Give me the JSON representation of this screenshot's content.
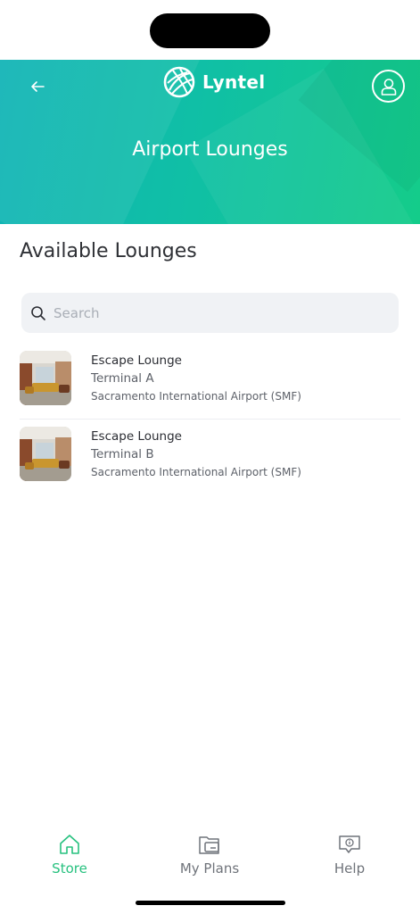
{
  "header": {
    "brand_name": "Lyntel",
    "page_title": "Airport Lounges",
    "icons": {
      "back": "arrow-left-icon",
      "logo": "globe-icon",
      "profile": "user-icon"
    }
  },
  "main": {
    "section_title": "Available Lounges",
    "search": {
      "placeholder": "Search",
      "value": ""
    },
    "lounges": [
      {
        "name": "Escape Lounge",
        "terminal": "Terminal A",
        "airport": "Sacramento International Airport (SMF)"
      },
      {
        "name": "Escape Lounge",
        "terminal": "Terminal B",
        "airport": "Sacramento International Airport (SMF)"
      }
    ]
  },
  "tab_bar": {
    "tabs": [
      {
        "label": "Store",
        "icon": "home-icon",
        "active": true
      },
      {
        "label": "My Plans",
        "icon": "folder-card-icon",
        "active": false
      },
      {
        "label": "Help",
        "icon": "help-chat-icon",
        "active": false
      }
    ]
  },
  "colors": {
    "accent": "#27c17f",
    "header_start": "#0fb3b5",
    "header_end": "#14cc8a"
  }
}
